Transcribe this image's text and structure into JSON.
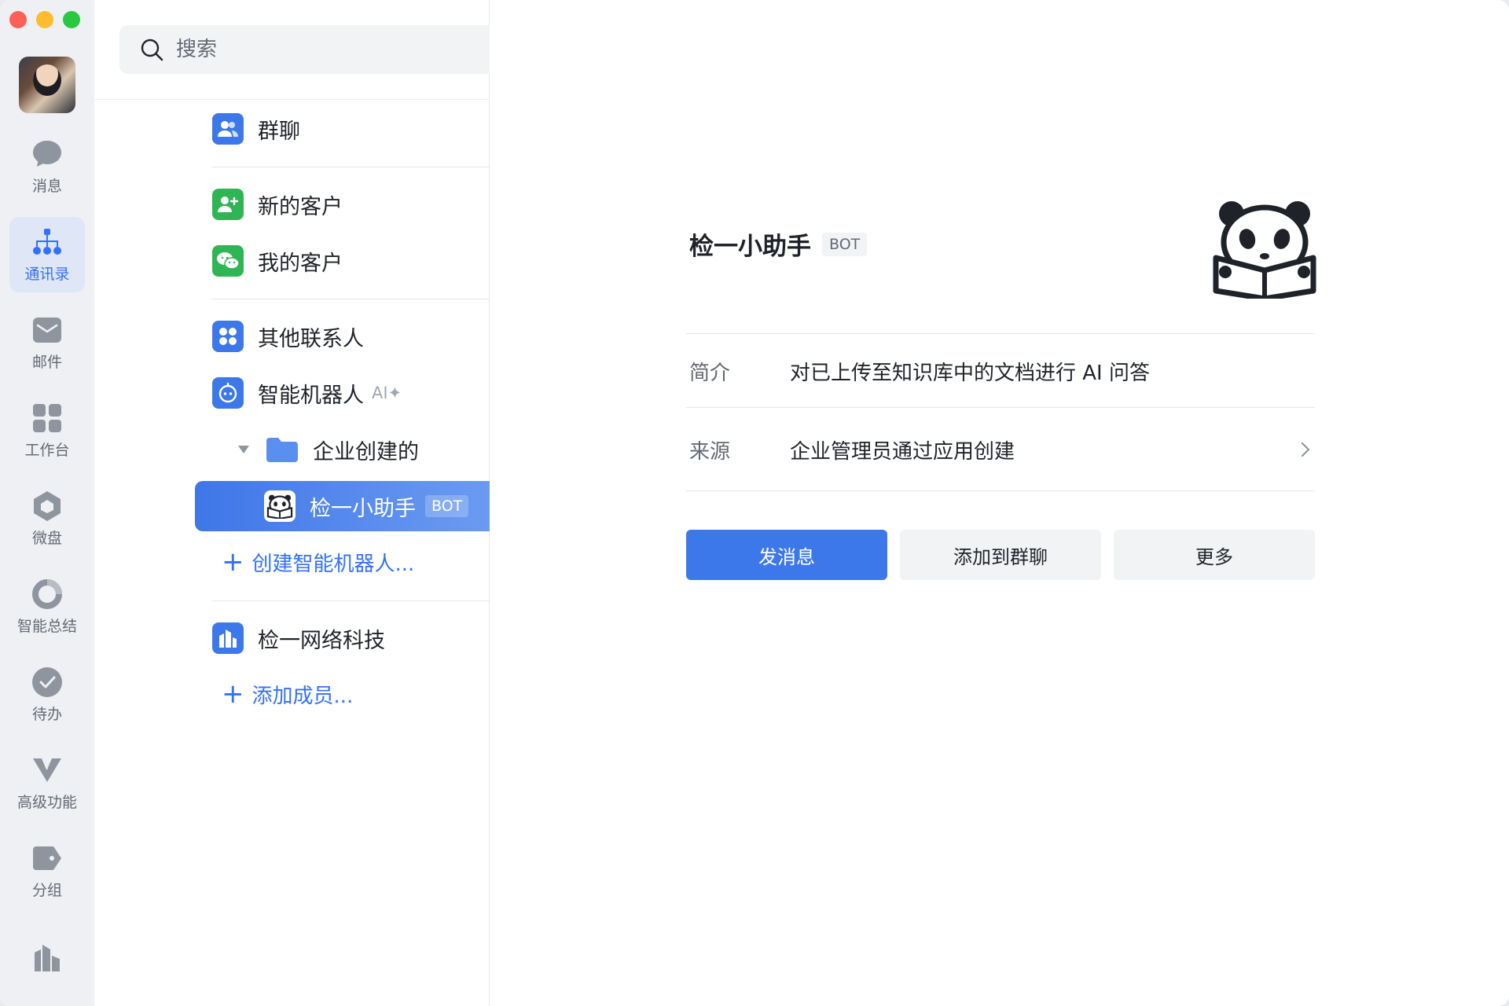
{
  "nav": {
    "items": [
      {
        "label": "消息",
        "icon": "message-icon"
      },
      {
        "label": "通讯录",
        "icon": "contacts-icon",
        "active": true
      },
      {
        "label": "邮件",
        "icon": "mail-icon"
      },
      {
        "label": "工作台",
        "icon": "workbench-icon"
      },
      {
        "label": "微盘",
        "icon": "drive-icon"
      },
      {
        "label": "智能总结",
        "icon": "summary-icon"
      },
      {
        "label": "待办",
        "icon": "todo-icon"
      },
      {
        "label": "高级功能",
        "icon": "advanced-icon"
      },
      {
        "label": "分组",
        "icon": "tag-icon"
      }
    ]
  },
  "search": {
    "placeholder": "搜索"
  },
  "list": {
    "group_chat": "群聊",
    "new_customers": "新的客户",
    "my_customers": "我的客户",
    "other_contacts": "其他联系人",
    "smart_robots": "智能机器人",
    "ai_tag": "AI✦",
    "folder": "企业创建的",
    "selected_bot": "检一小助手",
    "selected_bot_tag": "BOT",
    "create_robot": "创建智能机器人...",
    "company": "检一网络科技",
    "add_member": "添加成员..."
  },
  "detail": {
    "name": "检一小助手",
    "tag": "BOT",
    "intro_label": "简介",
    "intro_value": "对已上传至知识库中的文档进行 AI 问答",
    "source_label": "来源",
    "source_value": "企业管理员通过应用创建",
    "send_button": "发消息",
    "add_group_button": "添加到群聊",
    "more_button": "更多"
  },
  "colors": {
    "accent": "#3370ff",
    "primary_button": "#3d78ea",
    "rail_bg": "#eef0f3"
  }
}
